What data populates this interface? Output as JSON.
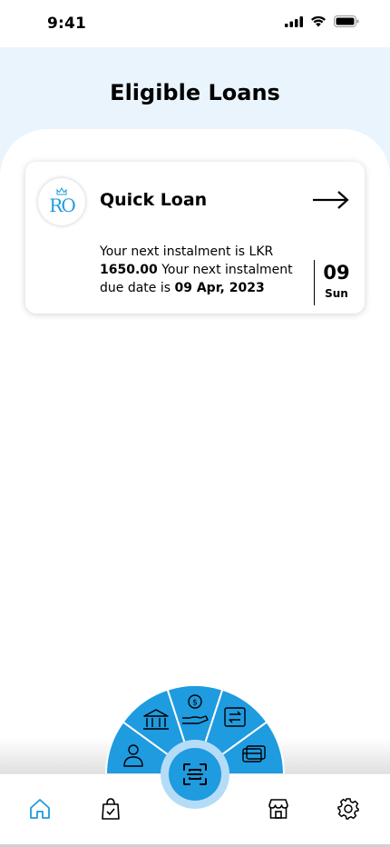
{
  "status_bar": {
    "time": "9:41"
  },
  "header": {
    "title": "Eligible Loans"
  },
  "loans": [
    {
      "logo_text": "RO",
      "name": "Quick Loan",
      "line_prefix": "Your next instalment is LKR",
      "amount": "1650.00",
      "line_mid": "Your next instalment due date is",
      "due_date": "09 Apr, 2023",
      "day": "09",
      "weekday": "Sun"
    }
  ],
  "colors": {
    "accent": "#1f9be0",
    "header_bg": "#eaf4fc",
    "scan_ring": "#b5dcf7"
  },
  "fan_menu": [
    "user-icon",
    "bank-icon",
    "money-hand-icon",
    "exchange-icon",
    "card-icon"
  ],
  "bottom_nav": [
    "home-icon",
    "shopping-bag-icon",
    "scan-icon",
    "store-icon",
    "settings-icon"
  ]
}
